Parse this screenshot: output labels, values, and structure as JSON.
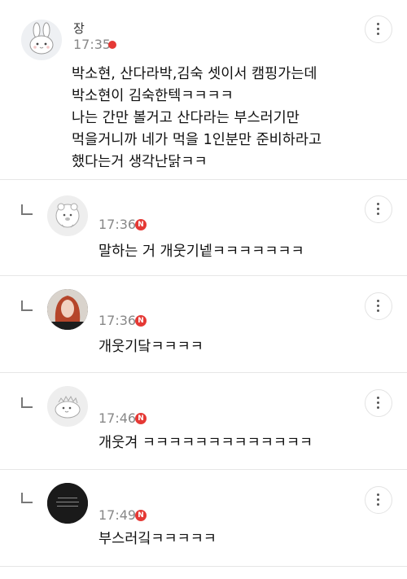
{
  "comments": [
    {
      "name": "장",
      "time": "17:35",
      "badge": "",
      "text": "박소현, 산다라박,김숙 셋이서 캠핑가는데\n박소현이 김숙한텍ㅋㅋㅋㅋ\n나는 간만 볼거고 산다라는 부스러기만\n먹을거니까 네가 먹을 1인분만 준비하라고\n했다는거 생각난닭ㅋㅋ",
      "avatar": "rabbit-icon"
    },
    {
      "name": "",
      "time": "17:36",
      "badge": "N",
      "text": "말하는 거 개웃기넽ㅋㅋㅋㅋㅋㅋㅋ",
      "avatar": "bear-icon"
    },
    {
      "name": "",
      "time": "17:36",
      "badge": "N",
      "text": "개웃기닼ㅋㅋㅋㅋ",
      "avatar": "photo-avatar"
    },
    {
      "name": "",
      "time": "17:46",
      "badge": "N",
      "text": "개웃겨 ㅋㅋㅋㅋㅋㅋㅋㅋㅋㅋㅋㅋㅋ",
      "avatar": "dinosaur-icon"
    },
    {
      "name": "",
      "time": "17:49",
      "badge": "N",
      "text": "부스러깈ㅋㅋㅋㅋㅋ",
      "avatar": "dark-avatar"
    }
  ],
  "colors": {
    "badge": "#e53935",
    "time": "#888888",
    "divider": "#e6e6e6"
  }
}
